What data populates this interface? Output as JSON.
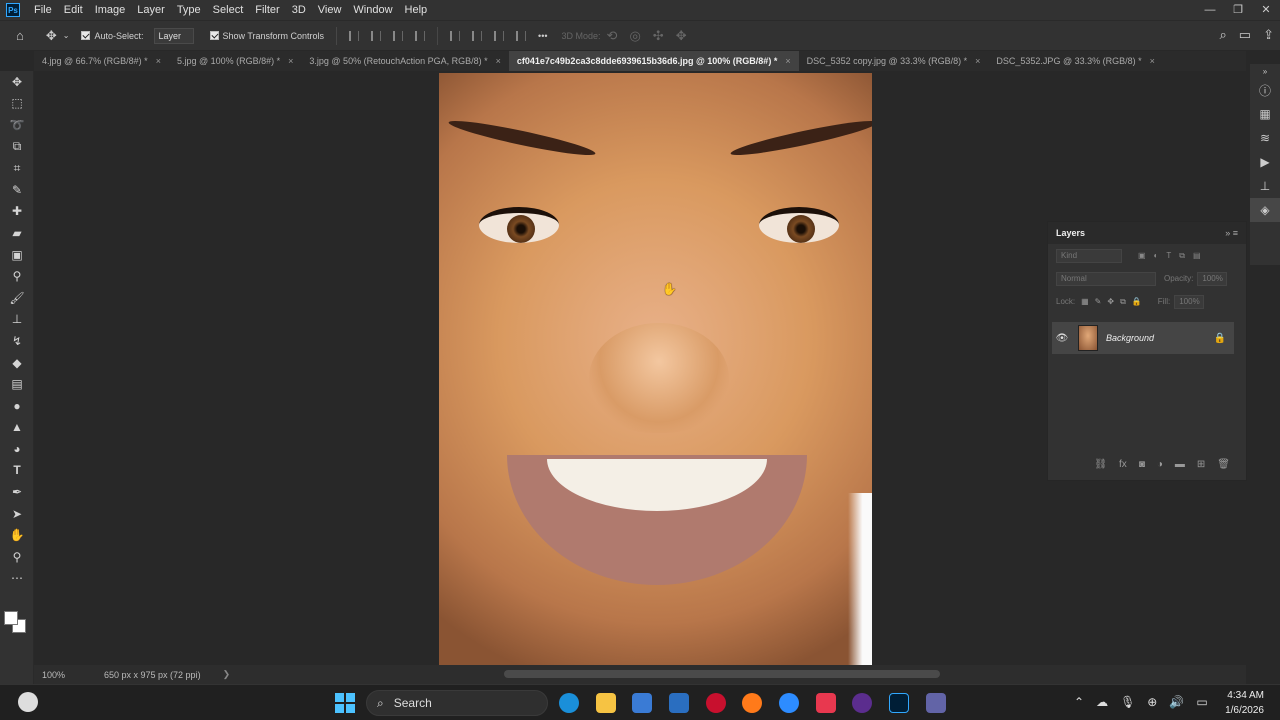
{
  "app": {
    "logo": "Ps"
  },
  "menu": [
    "File",
    "Edit",
    "Image",
    "Layer",
    "Type",
    "Select",
    "Filter",
    "3D",
    "View",
    "Window",
    "Help"
  ],
  "options": {
    "auto_select_label": "Auto-Select:",
    "auto_select_value": "Layer",
    "transform_label": "Show Transform Controls",
    "three_d_mode": "3D Mode:",
    "more": "•••"
  },
  "tabs": [
    {
      "label": "4.jpg @ 66.7% (RGB/8#) *"
    },
    {
      "label": "5.jpg @ 100% (RGB/8#) *"
    },
    {
      "label": "3.jpg @ 50% (RetouchAction PGA, RGB/8) *"
    },
    {
      "label": "cf041e7c49b2ca3c8dde6939615b36d6.jpg @ 100% (RGB/8#) *"
    },
    {
      "label": "DSC_5352 copy.jpg @ 33.3% (RGB/8) *"
    },
    {
      "label": "DSC_5352.JPG @ 33.3% (RGB/8) *"
    }
  ],
  "status": {
    "zoom": "100%",
    "doc_info": "650 px x 975 px (72 ppi)",
    "arrow": "❯"
  },
  "layers_panel": {
    "title": "Layers",
    "kind_placeholder": "Kind",
    "blend_mode": "Normal",
    "opacity_label": "Opacity:",
    "opacity_value": "100%",
    "lock_label": "Lock:",
    "fill_label": "Fill:",
    "fill_value": "100%",
    "layer_name": "Background"
  },
  "taskbar": {
    "search_label": "Search",
    "time": "4:34 AM",
    "date": "1/6/2026"
  },
  "colors": {
    "accent": "#31a8ff",
    "active_tab": "#424242",
    "panel": "#323232"
  }
}
